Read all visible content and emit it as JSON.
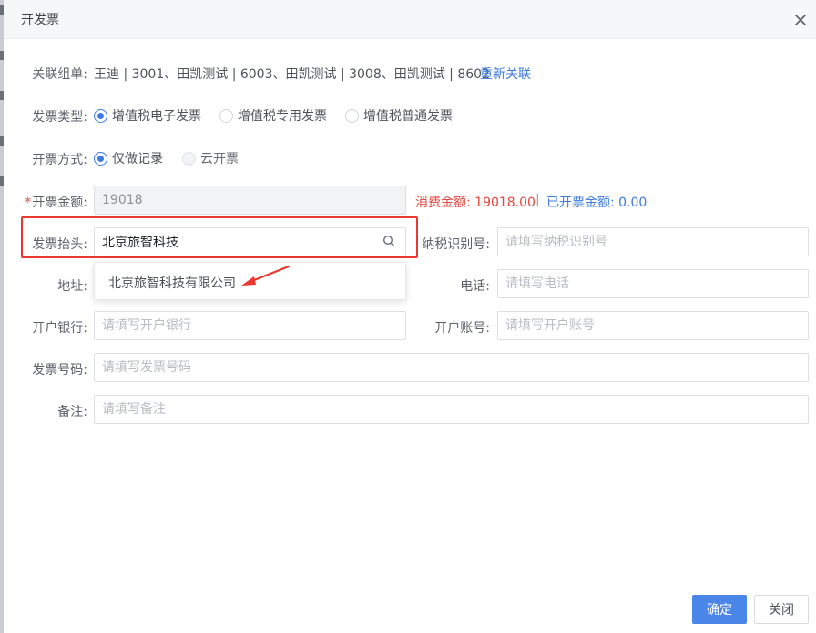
{
  "dialog": {
    "title": "开发票"
  },
  "form": {
    "related_orders": {
      "label": "关联组单:",
      "value": "王迪 | 3001、田凯测试 | 6003、田凯测试 | 3008、田凯测试 | 8602",
      "relink_link": "重新关联"
    },
    "invoice_type": {
      "label": "发票类型:",
      "options": [
        "增值税电子发票",
        "增值税专用发票",
        "增值税普通发票"
      ],
      "selected": "增值税电子发票"
    },
    "issue_method": {
      "label": "开票方式:",
      "options": [
        "仅做记录",
        "云开票"
      ],
      "selected": "仅做记录"
    },
    "invoice_amount": {
      "required_mark": "*",
      "label": "开票金额:",
      "value": "19018",
      "consume_amount": "消费金额: 19018.00",
      "separator": "|",
      "issued_amount": "已开票金额: 0.00"
    },
    "invoice_header": {
      "label": "发票抬头:",
      "value": "北京旅智科技",
      "suggestion": "北京旅智科技有限公司"
    },
    "tax_id": {
      "label": "纳税识别号:",
      "placeholder": "请填写纳税识别号"
    },
    "address": {
      "label": "地址:"
    },
    "phone": {
      "label": "电话:",
      "placeholder": "请填写电话"
    },
    "bank": {
      "label": "开户银行:",
      "placeholder": "请填写开户银行"
    },
    "account": {
      "label": "开户账号:",
      "placeholder": "请填写开户账号"
    },
    "invoice_number": {
      "label": "发票号码:",
      "placeholder": "请填写发票号码"
    },
    "remark": {
      "label": "备注:",
      "placeholder": "请填写备注"
    }
  },
  "footer": {
    "confirm_label": "确定",
    "close_label": "关闭"
  },
  "colors": {
    "primary": "#4a86e8",
    "link": "#3d7be0",
    "danger": "#e8463f",
    "highlight": "#e9382f"
  },
  "icons": {
    "close": "close-icon",
    "search": "search-icon",
    "arrow": "red-arrow-icon"
  }
}
